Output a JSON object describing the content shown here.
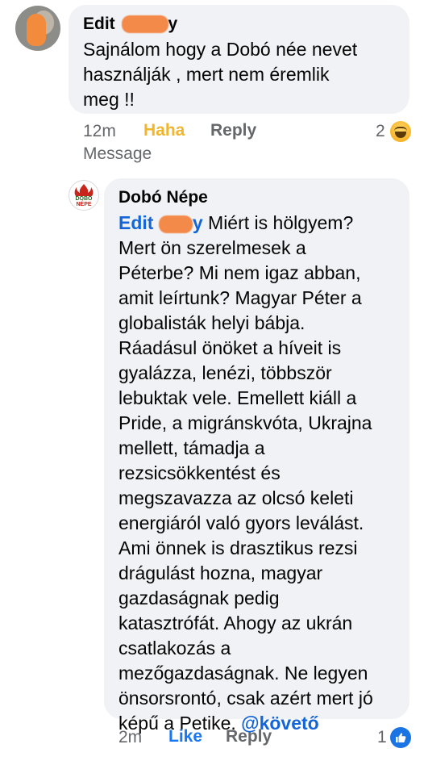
{
  "comment": {
    "author_first": "Edit",
    "author_last_fragment": "y",
    "lines": [
      "Sajnálom hogy a Dobó née nevet",
      "használják , mert nem éremlik",
      "meg !!"
    ],
    "time": "12m",
    "reaction_label": "Haha",
    "reply_label": "Reply",
    "message_label": "Message",
    "reaction_count": "2",
    "reaction_icon": "haha-emoji-icon"
  },
  "reply": {
    "author": "Dobó Népe",
    "mention_first": "Edit",
    "mention_last_fragment": "y",
    "first_line_rest": "Miért is hölgyem?",
    "lines": [
      "Mert ön szerelmesek a",
      "Péterbe? Mi nem igaz abban,",
      "amit leírtunk? Magyar Péter a",
      "globalisták helyi bábja.",
      "Ráadásul önöket a híveit is",
      "gyalázza, lenézi, többször",
      "lebuktak vele. Emellett kiáll a",
      "Pride, a migránskvóta, Ukrajna",
      "mellett, támadja a",
      "rezsicsökkentést és",
      "megszavazza az olcsó keleti",
      "energiáról való gyors leválást.",
      "Ami önnek is drasztikus rezsi",
      "drágulást hozna, magyar",
      "gazdaságnak pedig",
      "katasztrófát. Ahogy az ukrán",
      "csatlakozás a",
      "mezőgazdaságnak. Ne legyen",
      "önsorsrontó, csak azért mert jó"
    ],
    "last_line_text": "képű a Petike.",
    "last_line_tag": "@követő",
    "avatar_text": "DOBÓ NÉPE",
    "time": "2m",
    "like_label": "Like",
    "reply_label": "Reply",
    "reaction_count": "1",
    "reaction_icon": "thumbs-up-icon"
  },
  "colors": {
    "bubble": "#f0f2f5",
    "meta_text": "#65676b",
    "haha": "#f2b52e",
    "like": "#1877f2",
    "mention": "#1465d8",
    "redaction": "#f48a4a"
  }
}
